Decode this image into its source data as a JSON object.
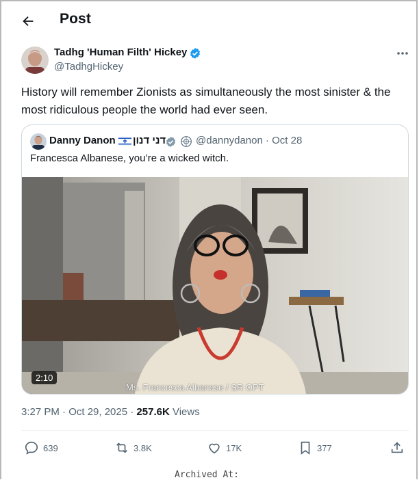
{
  "header": {
    "title": "Post"
  },
  "tweet": {
    "author_name": "Tadhg 'Human Filth' Hickey",
    "author_handle": "@TadhgHickey",
    "text": "History will remember Zionists as simultaneously the most sinister & the most ridiculous people the world had ever seen.",
    "time": "3:27 PM · Oct 29, 2025 · ",
    "views_count": "257.6K",
    "views_label": " Views"
  },
  "quote": {
    "author_name": "Danny Danon",
    "hebrew_name": "דני דנון",
    "handle_date": "@dannydanon · Oct 28",
    "text": "Francesca Albanese, you’re a wicked witch.",
    "video_duration": "2:10",
    "video_caption": "Ms. Francesca Albanese / SR OPT"
  },
  "actions": {
    "replies": "639",
    "reposts": "3.8K",
    "likes": "17K",
    "bookmarks": "377"
  },
  "footer": {
    "archived_label": "Archived At:"
  },
  "colors": {
    "verified": "#1d9bf0",
    "muted": "#536471",
    "text": "#0f1419"
  }
}
